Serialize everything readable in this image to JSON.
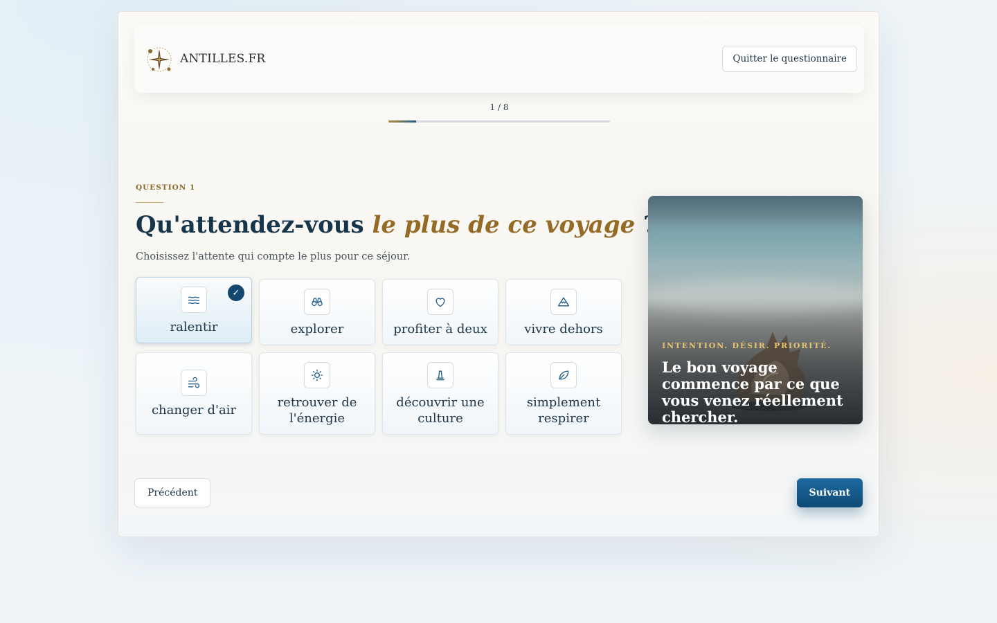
{
  "header": {
    "logo_text": "ANTILLES.FR",
    "quit_label": "Quitter le questionnaire"
  },
  "progress": {
    "label": "1 / 8",
    "current": 1,
    "total": 8,
    "fraction": 0.125
  },
  "question": {
    "kicker": "QUESTION 1",
    "title_start": "Qu'attendez-vous ",
    "title_emphasis": "le plus de ce voyage",
    "title_end": " ?",
    "subtitle": "Choisissez l'attente qui compte le plus pour ce séjour."
  },
  "options": [
    {
      "label": "ralentir",
      "icon": "waves-icon",
      "selected": true
    },
    {
      "label": "explorer",
      "icon": "binoculars-icon",
      "selected": false
    },
    {
      "label": "profiter à deux",
      "icon": "heart-icon",
      "selected": false
    },
    {
      "label": "vivre dehors",
      "icon": "mountain-icon",
      "selected": false
    },
    {
      "label": "changer d'air",
      "icon": "wind-icon",
      "selected": false
    },
    {
      "label": "retrouver de l'énergie",
      "icon": "sun-icon",
      "selected": false
    },
    {
      "label": "découvrir une culture",
      "icon": "monument-icon",
      "selected": false
    },
    {
      "label": "simplement respirer",
      "icon": "leaf-icon",
      "selected": false
    }
  ],
  "aside": {
    "kicker": "INTENTION. DÉSIR. PRIORITÉ.",
    "caption": "Le bon voyage commence par ce que vous venez réellement chercher."
  },
  "nav": {
    "prev_label": "Précédent",
    "next_label": "Suivant"
  },
  "colors": {
    "accent": "#1f5d8a",
    "gold": "#946a24",
    "primary_button": "#0f4a75"
  }
}
